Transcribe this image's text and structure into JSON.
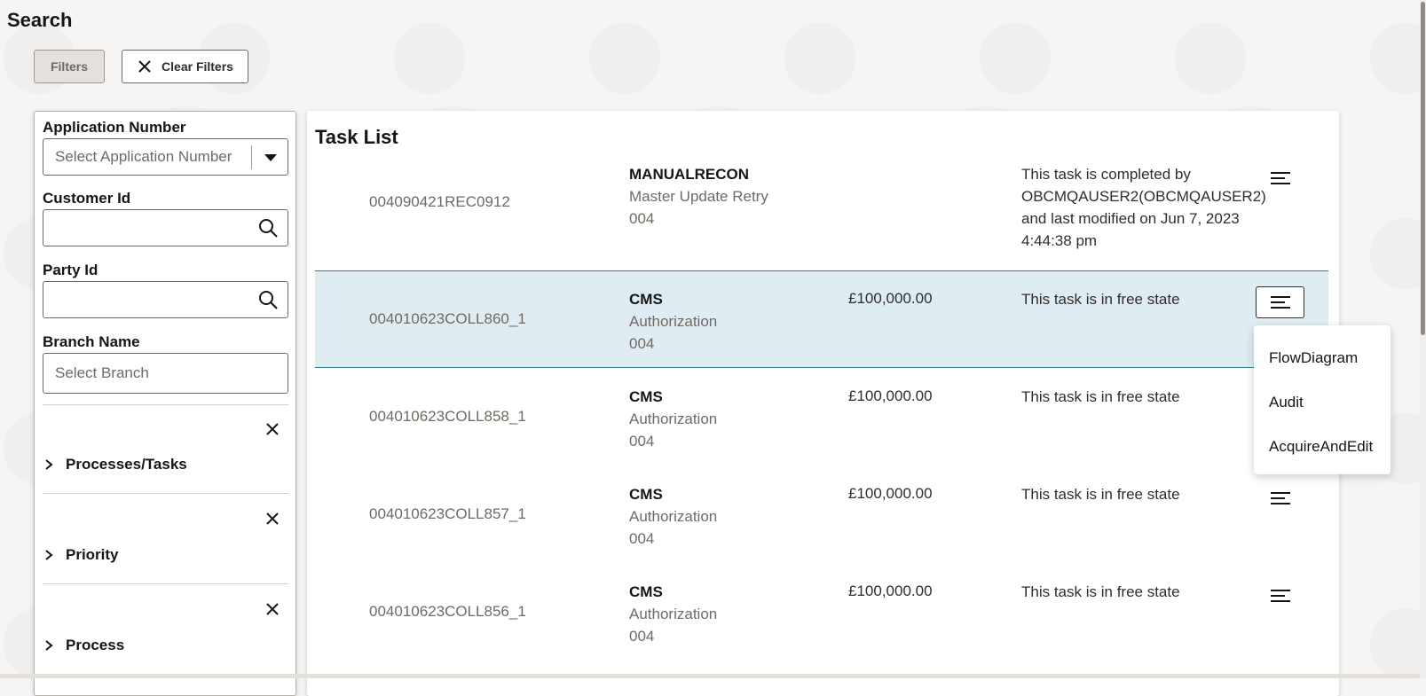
{
  "page": {
    "title": "Search"
  },
  "toolbar": {
    "filters_label": "Filters",
    "clear_label": "Clear Filters"
  },
  "filters": {
    "application_number": {
      "label": "Application Number",
      "placeholder": "Select Application Number"
    },
    "customer_id": {
      "label": "Customer Id",
      "value": ""
    },
    "party_id": {
      "label": "Party Id",
      "value": ""
    },
    "branch_name": {
      "label": "Branch Name",
      "placeholder": "Select Branch"
    },
    "sections": [
      {
        "label": "Processes/Tasks"
      },
      {
        "label": "Priority"
      },
      {
        "label": "Process"
      }
    ]
  },
  "task_list": {
    "title": "Task List",
    "rows": [
      {
        "id": "004090421REC0912",
        "type": "MANUALRECON",
        "stage": "Master Update Retry",
        "branch": "004",
        "amount": "",
        "status": "This task is completed by OBCMQAUSER2(OBCMQAUSER2) and last modified on Jun 7, 2023 4:44:38 pm",
        "selected": false
      },
      {
        "id": "004010623COLL860_1",
        "type": "CMS",
        "stage": "Authorization",
        "branch": "004",
        "amount": "£100,000.00",
        "status": "This task is in free state",
        "selected": true
      },
      {
        "id": "004010623COLL858_1",
        "type": "CMS",
        "stage": "Authorization",
        "branch": "004",
        "amount": "£100,000.00",
        "status": "This task is in free state",
        "selected": false
      },
      {
        "id": "004010623COLL857_1",
        "type": "CMS",
        "stage": "Authorization",
        "branch": "004",
        "amount": "£100,000.00",
        "status": "This task is in free state",
        "selected": false
      },
      {
        "id": "004010623COLL856_1",
        "type": "CMS",
        "stage": "Authorization",
        "branch": "004",
        "amount": "£100,000.00",
        "status": "This task is in free state",
        "selected": false
      }
    ]
  },
  "row_menu": {
    "items": [
      {
        "label": "FlowDiagram"
      },
      {
        "label": "Audit"
      },
      {
        "label": "AcquireAndEdit"
      }
    ]
  },
  "icons": {
    "close": "close-icon",
    "search": "search-icon",
    "chevron": "chevron-right-icon",
    "menu": "hamburger-icon",
    "caret": "caret-down-icon"
  }
}
